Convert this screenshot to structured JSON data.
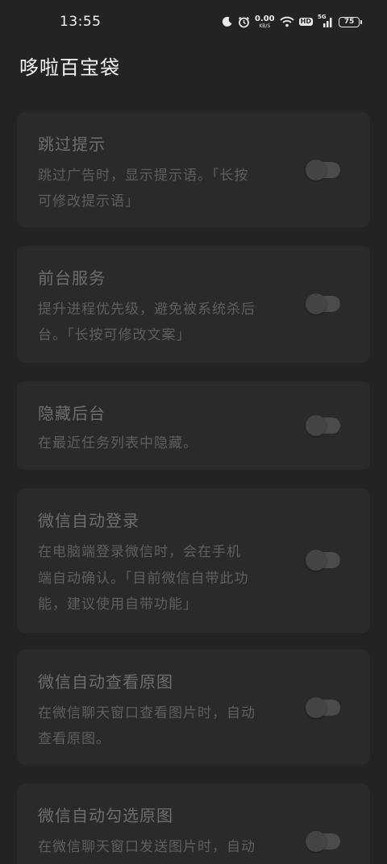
{
  "status_bar": {
    "time": "13:55",
    "net_speed_value": "0.00",
    "net_speed_unit": "KB/S",
    "hd_label": "HD",
    "network_label": "5G",
    "battery_level": "75",
    "icons": [
      "moon-icon",
      "alarm-icon",
      "wifi-icon",
      "signal-icon",
      "battery-icon"
    ]
  },
  "app": {
    "title": "哆啦百宝袋"
  },
  "settings": [
    {
      "title": "跳过提示",
      "desc_lines": [
        "跳过广告时，显示提示语。「长按",
        "可修改提示语」"
      ],
      "enabled": false
    },
    {
      "title": "前台服务",
      "desc_lines": [
        "提升进程优先级，避免被系统杀后",
        "台。「长按可修改文案」"
      ],
      "enabled": false
    },
    {
      "title": "隐藏后台",
      "desc_lines": [
        "在最近任务列表中隐藏。"
      ],
      "enabled": false
    },
    {
      "title": "微信自动登录",
      "desc_lines": [
        "在电脑端登录微信时，会在手机",
        "端自动确认。「目前微信自带此功",
        "能，建议使用自带功能」"
      ],
      "enabled": false
    },
    {
      "title": "微信自动查看原图",
      "desc_lines": [
        "在微信聊天窗口查看图片时，自动",
        "查看原图。"
      ],
      "enabled": false
    },
    {
      "title": "微信自动勾选原图",
      "desc_lines": [
        "在微信聊天窗口发送图片时，自动"
      ],
      "enabled": false
    }
  ]
}
